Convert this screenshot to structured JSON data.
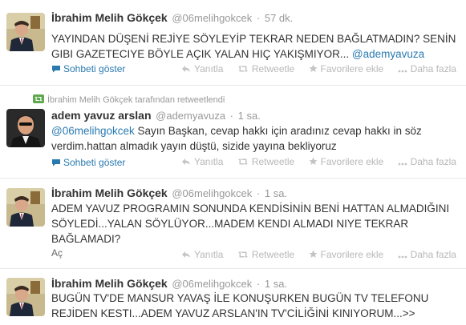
{
  "tweets": [
    {
      "fullname": "İbrahim Melih Gökçek",
      "username": "@06melihgokcek",
      "time": "57 dk.",
      "text": "YAYINDAN DÜŞENİ REJİYE SÖYLEYİP TEKRAR NEDEN BAĞLATMADIN? SENİN GIBI GAZETECIYE BÖYLE AÇIK YALAN HIÇ YAKIŞMIYOR... ",
      "mention": "@ademyavuza",
      "expand_label": "Sohbeti göster"
    },
    {
      "retweet_by": "İbrahim Melih Gökçek tarafından retweetlendi",
      "fullname": "adem yavuz arslan",
      "username": "@ademyavuza",
      "time": "1 sa.",
      "mention": "@06melihgokcek",
      "text": " Sayın Başkan, cevap hakkı için aradınız cevap hakkı in söz verdim.hattan almadık yayın düştü, sizide yayına bekliyoruz",
      "expand_label": "Sohbeti göster"
    },
    {
      "fullname": "İbrahim Melih Gökçek",
      "username": "@06melihgokcek",
      "time": "1 sa.",
      "text": "ADEM YAVUZ PROGRAMIN SONUNDA KENDİSİNİN BENİ HATTAN ALMADIĞINI SÖYLEDİ...YALAN SÖYLÜYOR...MADEM KENDI ALMADI NIYE TEKRAR BAĞLAMADI?",
      "expand_label": "Aç"
    },
    {
      "fullname": "İbrahim Melih Gökçek",
      "username": "@06melihgokcek",
      "time": "1 sa.",
      "text": "BUGÜN TV'DE MANSUR YAVAŞ İLE  KONUŞURKEN BUGÜN TV TELEFONU REJİDEN KESTI...ADEM YAVUZ ARSLAN'IN TV'CİLİĞİNİ KINIYORUM...>>"
    }
  ],
  "actions": {
    "reply": "Yanıtla",
    "retweet": "Retweetle",
    "favorite": "Favorilere ekle",
    "more": "Daha fazla"
  },
  "colors": {
    "link": "#2a7ab0",
    "muted": "#999999",
    "action": "#b8b8b8",
    "text": "#333333"
  },
  "icons": [
    "retweet-icon",
    "reply-icon",
    "favorite-star-icon",
    "more-dots-icon",
    "conversation-bubble-icon"
  ]
}
